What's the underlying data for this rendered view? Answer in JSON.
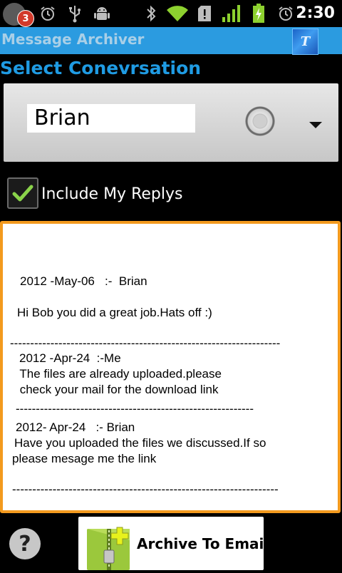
{
  "status_bar": {
    "notification_badge": "3",
    "time": "2:30",
    "icons": [
      "app-notification-icon",
      "alarm-icon",
      "usb-icon",
      "android-debug-icon",
      "bluetooth-icon",
      "wifi-icon",
      "sd-card-warning-icon",
      "signal-icon",
      "battery-charging-icon",
      "alarm-icon"
    ]
  },
  "title_bar": {
    "title": "Message Archiver",
    "logo_text": "T"
  },
  "heading": "Select Conevrsation",
  "spinner": {
    "value": "Brian"
  },
  "include_replies": {
    "label": "Include My Replys",
    "checked": true
  },
  "conversation": {
    "lines": [
      "2012 -May-06   :-  Brian",
      "Hi Bob you did a great job.Hats off :)",
      "-------------------------------------------------------------------",
      "2012 -Apr-24  :-Me",
      " The files are already uploaded.please",
      " check your mail for the download link",
      "-----------------------------------------------------------",
      "2012- Apr-24   :- Brian",
      "Have you uploaded the files we discussed.If so",
      "please mesage me the link",
      "------------------------------------------------------------------"
    ]
  },
  "bottom": {
    "help_label": "?",
    "archive_label": "Archive To Email"
  },
  "colors": {
    "title_bar": "#2b9be0",
    "heading": "#1f9be3",
    "conv_border": "#f39a1e",
    "checkmark": "#8ad34a"
  }
}
